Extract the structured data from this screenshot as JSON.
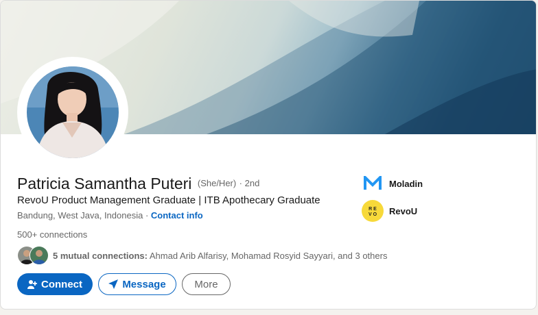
{
  "profile": {
    "name": "Patricia Samantha Puteri",
    "pronouns": "(She/Her)",
    "degree": "· 2nd",
    "headline": "RevoU Product Management Graduate | ITB Apothecary Graduate",
    "location": "Bandung, West Java, Indonesia",
    "location_sep": " · ",
    "contact_info": "Contact info",
    "connections": "500+ connections",
    "mutual_bold": "5 mutual connections:",
    "mutual_names": " Ahmad Arib Alfarisy, Mohamad Rosyid Sayyari, and 3 others"
  },
  "actions": {
    "connect_label": "Connect",
    "message_label": "Message",
    "more_label": "More"
  },
  "organizations": [
    {
      "name": "Moladin",
      "icon": "moladin-logo",
      "color": "#2196f3"
    },
    {
      "name": "RevoU",
      "icon": "revou-logo",
      "color": "#f7d93a"
    }
  ],
  "colors": {
    "accent": "#0a66c2",
    "text": "#191919",
    "muted": "#666666"
  }
}
